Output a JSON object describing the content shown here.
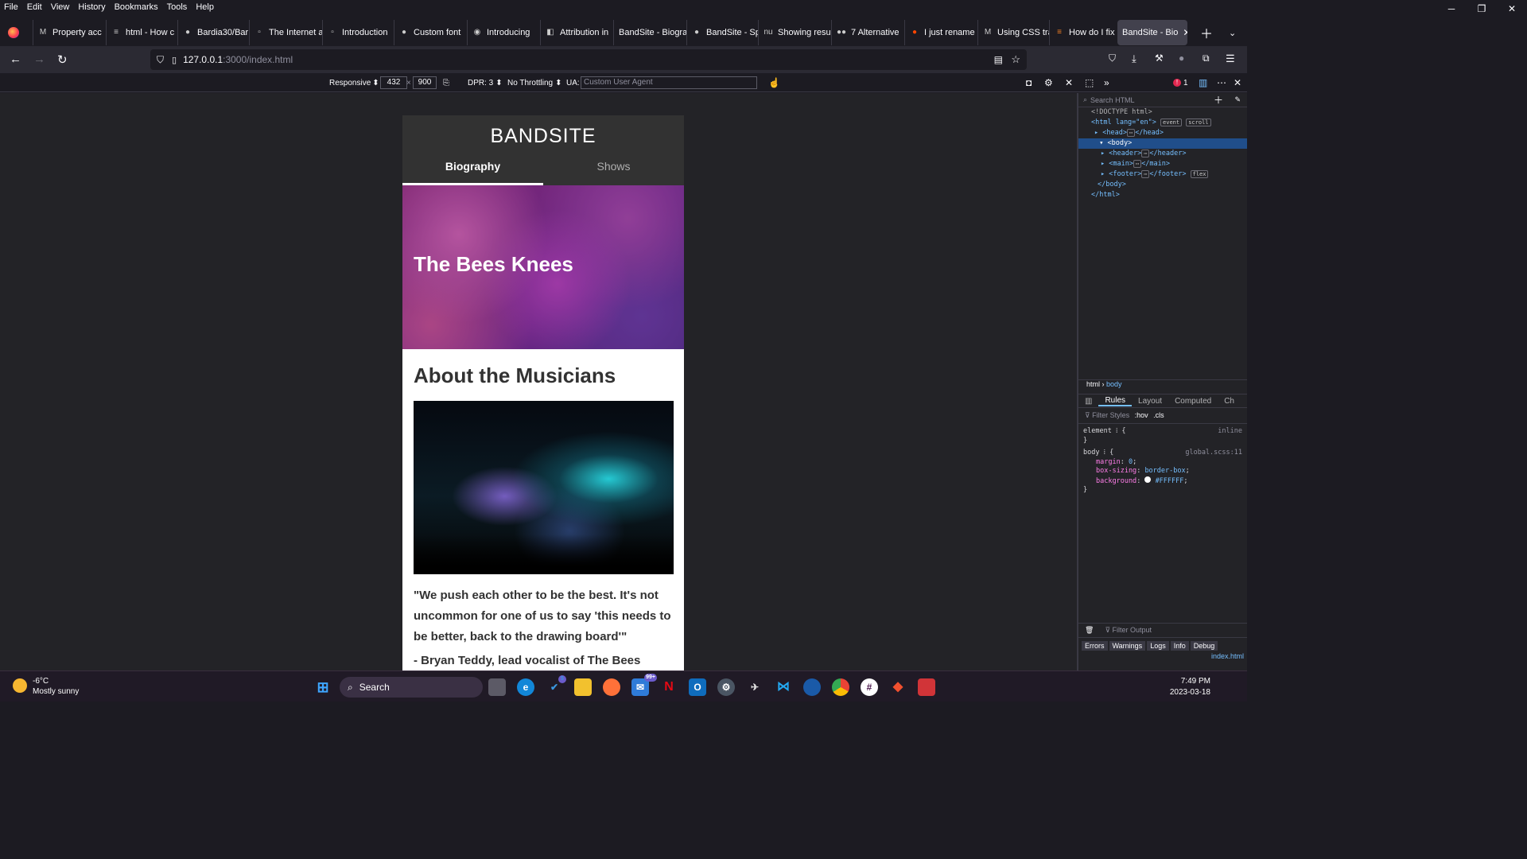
{
  "menu": [
    "File",
    "Edit",
    "View",
    "History",
    "Bookmarks",
    "Tools",
    "Help"
  ],
  "window_controls": [
    "─",
    "❐",
    "✕"
  ],
  "tabs": [
    {
      "label": "Property acc",
      "icon": "M"
    },
    {
      "label": "html - How c",
      "icon": "≡"
    },
    {
      "label": "Bardia30/Bar",
      "icon": "●"
    },
    {
      "label": "The Internet a",
      "icon": "▫"
    },
    {
      "label": "Introduction",
      "icon": "▫"
    },
    {
      "label": "Custom font",
      "icon": "●"
    },
    {
      "label": "Introducing",
      "icon": "◉"
    },
    {
      "label": "Attribution in",
      "icon": "◧"
    },
    {
      "label": "BandSite - Biogra",
      "icon": ""
    },
    {
      "label": "BandSite - Sp",
      "icon": ""
    },
    {
      "label": "Showing resu",
      "icon": "nu"
    },
    {
      "label": "7 Alternative",
      "icon": "●●"
    },
    {
      "label": "I just rename",
      "icon": "●"
    },
    {
      "label": "Using CSS tra",
      "icon": "M"
    },
    {
      "label": "How do I fix",
      "icon": "≡"
    },
    {
      "label": "BandSite - Bio",
      "icon": "",
      "active": true
    }
  ],
  "url": {
    "host": "127.0.0.1",
    "path": ":3000/index.html"
  },
  "rdm": {
    "device": "Responsive",
    "width": "432",
    "height": "900",
    "dpr": "DPR: 3",
    "throttling": "No Throttling",
    "ua_label": "UA:",
    "ua_placeholder": "Custom User Agent",
    "error_count": "1"
  },
  "site": {
    "title": "BANDSITE",
    "nav": [
      "Biography",
      "Shows"
    ],
    "hero_title": "The Bees Knees",
    "about_title": "About the Musicians",
    "quote": "\"We push each other to be the best. It's not uncommon for one of us to say 'this needs to be better, back to the drawing board'\"",
    "quote_author": "- Bryan Teddy, lead vocalist of The Bees"
  },
  "devtools": {
    "search_placeholder": "Search HTML",
    "tree": {
      "doctype": "<!DOCTYPE html>",
      "html_open": "<html lang=\"en\">",
      "head": "<head>",
      "head_end": "</head>",
      "body": "<body>",
      "header": "<header>",
      "header_end": "</header>",
      "main": "<main>",
      "main_end": "</main>",
      "footer": "<footer>",
      "footer_end": "</footer>",
      "body_close": "</body>",
      "html_close": "</html>",
      "badge_event": "event",
      "badge_scroll": "scroll",
      "badge_flex": "flex",
      "ellipsis": "⋯"
    },
    "breadcrumbs": [
      "html",
      "body"
    ],
    "tabs": [
      "Rules",
      "Layout",
      "Computed",
      "Ch"
    ],
    "filter_placeholder": "Filter Styles",
    "filter_toggles": [
      ":hov",
      ".cls"
    ],
    "rules": [
      {
        "selector": "element",
        "source": "inline",
        "props": []
      },
      {
        "selector": "body",
        "source": "global.scss:11",
        "props": [
          {
            "name": "margin",
            "value": "0"
          },
          {
            "name": "box-sizing",
            "value": "border-box"
          },
          {
            "name": "background",
            "value": "#FFFFFF"
          }
        ]
      }
    ],
    "console_filter": "Filter Output",
    "console_buttons": [
      "Errors",
      "Warnings",
      "Logs",
      "Info",
      "Debug"
    ],
    "console_file": "index.html"
  },
  "taskbar": {
    "weather_temp": "-6°C",
    "weather_desc": "Mostly sunny",
    "search_label": "Search",
    "time": "7:49 PM",
    "date": "2023-03-18",
    "badges": {
      "todo": "5",
      "mail": "99+"
    }
  }
}
